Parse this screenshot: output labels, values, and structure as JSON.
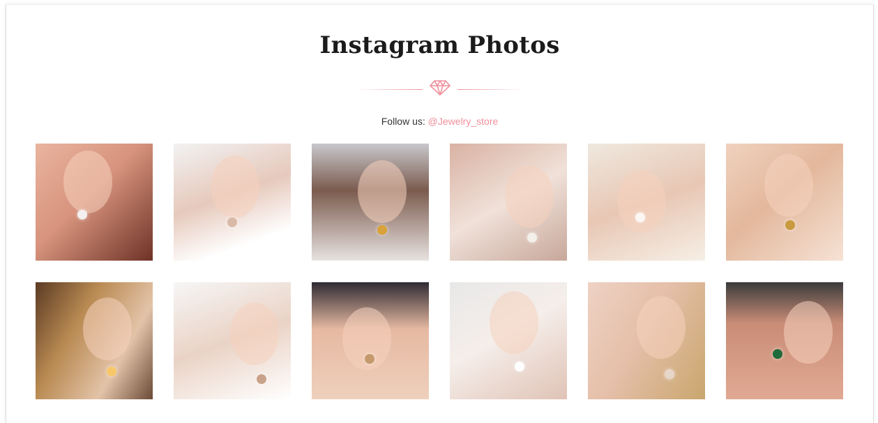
{
  "section": {
    "title": "Instagram Photos",
    "follow_label": "Follow us: ",
    "follow_handle": "@Jewelry_store",
    "accent_color": "#ef8f9b"
  },
  "photos": [
    {
      "name": "photo-ear-cuff-earring",
      "bg": "linear-gradient(135deg,#e9b59f 0%,#d7937d 45%,#6e3226 100%)",
      "accent": "#f3f0ee"
    },
    {
      "name": "photo-drop-earring-white-top",
      "bg": "linear-gradient(160deg,#f2f2f2 0%,#e6c9bc 45%,#ffffff 80%)",
      "accent": "#d9b9a7"
    },
    {
      "name": "photo-woman-pendant-necklace",
      "bg": "linear-gradient(180deg,#c8c8cc 0%,#7b5b4e 40%,#e7e2df 100%)",
      "accent": "#d9a23a"
    },
    {
      "name": "photo-chandelier-earrings",
      "bg": "linear-gradient(150deg,#d9b2a3 0%,#f0e1d9 50%,#c7a79a 100%)",
      "accent": "#f3f0ea"
    },
    {
      "name": "photo-pearl-necklace",
      "bg": "linear-gradient(160deg,#efe8df 0%,#e8c7b4 50%,#f6efe6 100%)",
      "accent": "#fbf7f2"
    },
    {
      "name": "photo-gold-hoop-earrings",
      "bg": "linear-gradient(140deg,#f0d2bf 0%,#e3b89c 45%,#f6e2d5 100%)",
      "accent": "#c99a3e"
    },
    {
      "name": "photo-woman-bokeh-lights",
      "bg": "linear-gradient(120deg,#5b3b24 0%,#b98a52 35%,#e3c3a8 70%,#6a4a36 100%)",
      "accent": "#f6c86a"
    },
    {
      "name": "photo-woman-bridal-earrings",
      "bg": "linear-gradient(160deg,#f6f6f6 0%,#ead3c6 50%,#ffffff 100%)",
      "accent": "#c9a28b"
    },
    {
      "name": "photo-handbag-sunglasses",
      "bg": "linear-gradient(180deg,#2f2b33 0%,#e6b9a1 40%,#efd0bd 100%)",
      "accent": "#c49a6c"
    },
    {
      "name": "photo-pearl-bracelet",
      "bg": "linear-gradient(150deg,#e8e8e8 0%,#f5eeea 45%,#e0c3b6 100%)",
      "accent": "#ffffff"
    },
    {
      "name": "photo-pendant-gold-background",
      "bg": "linear-gradient(120deg,#eed2c4 0%,#e5bfa9 45%,#c9a66d 100%)",
      "accent": "#e6d7c9"
    },
    {
      "name": "photo-emerald-necklace",
      "bg": "linear-gradient(180deg,#3b3b3b 0%,#c98d77 35%,#e1a993 100%)",
      "accent": "#1f6b3b"
    }
  ]
}
